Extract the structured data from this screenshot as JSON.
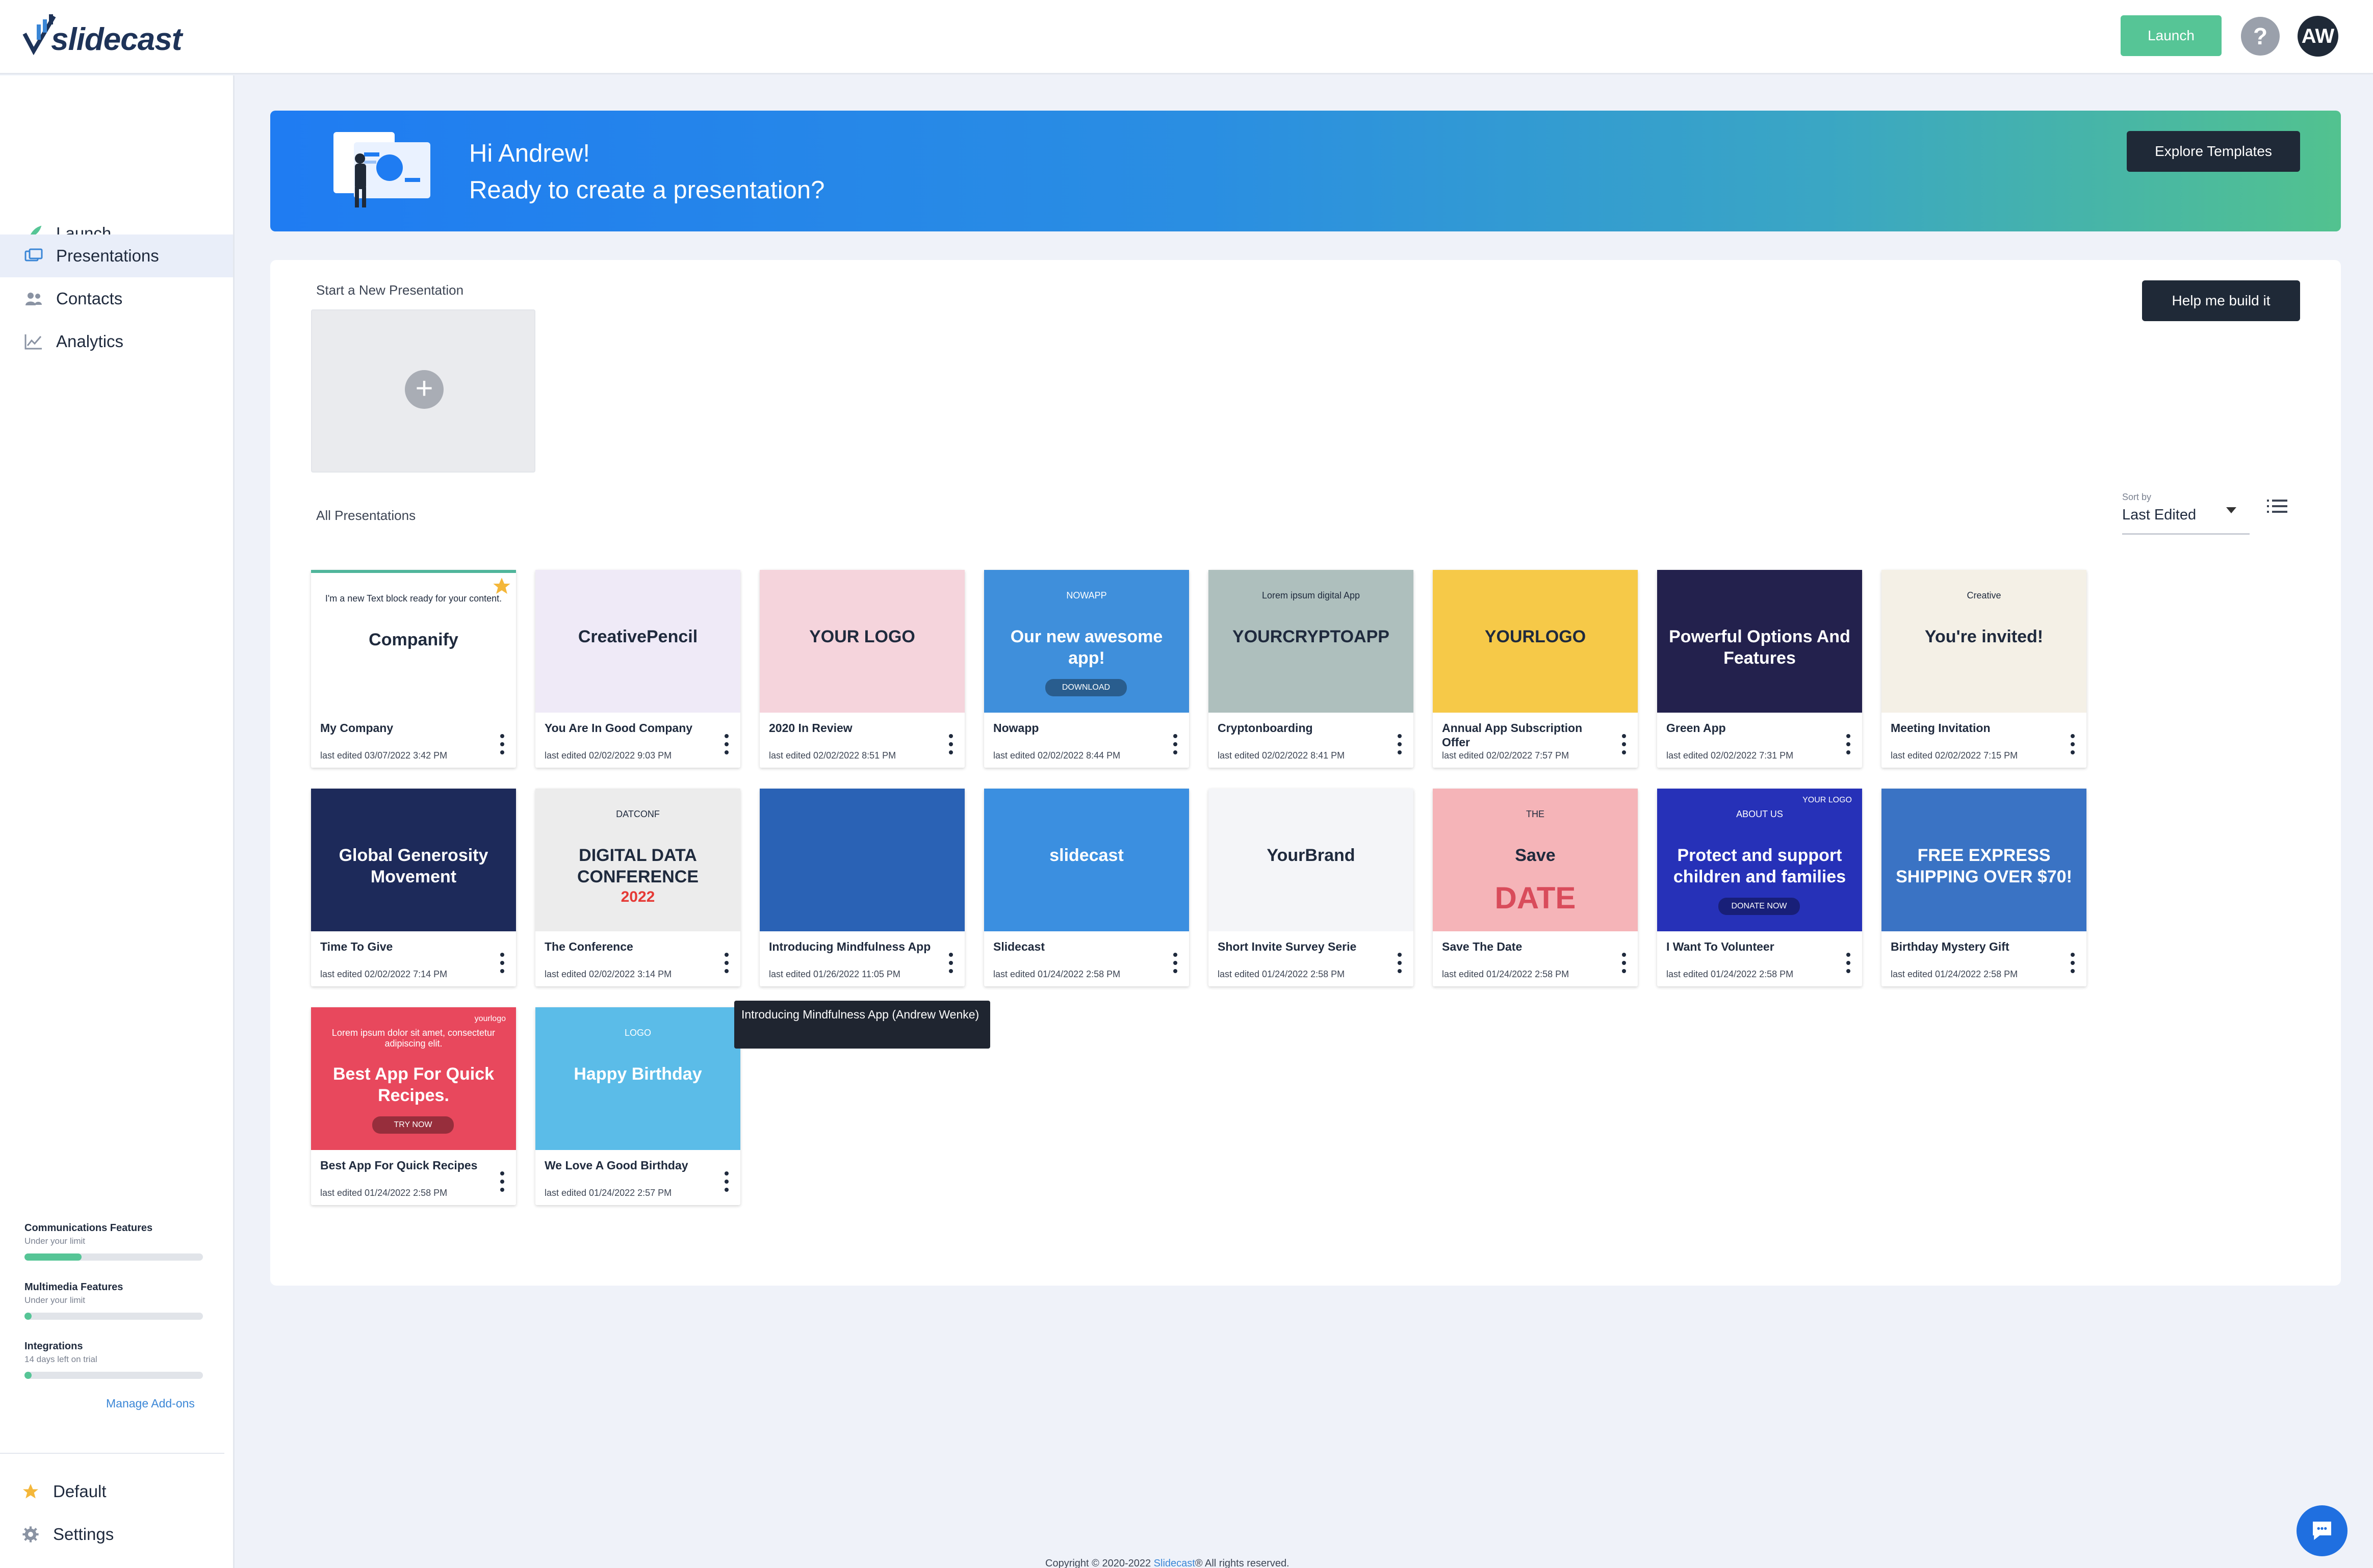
{
  "app": {
    "logo_text": "slidecast"
  },
  "topbar": {
    "launch_label": "Launch",
    "help_label": "?",
    "avatar_initials": "AW"
  },
  "sidebar": {
    "items": [
      {
        "label": "Launch",
        "icon": "rocket-icon"
      },
      {
        "label": "Presentations",
        "icon": "presentations-icon"
      },
      {
        "label": "Contacts",
        "icon": "contacts-icon"
      },
      {
        "label": "Analytics",
        "icon": "analytics-icon"
      }
    ],
    "features": [
      {
        "title": "Communications Features",
        "subtitle": "Under your limit",
        "progress": 0.32
      },
      {
        "title": "Multimedia Features",
        "subtitle": "Under your limit",
        "progress": 0.04
      },
      {
        "title": "Integrations",
        "subtitle": "14 days left on trial",
        "progress": 0.04
      }
    ],
    "manage_addons": "Manage Add-ons",
    "bottom": [
      {
        "label": "Default",
        "icon": "star-icon"
      },
      {
        "label": "Settings",
        "icon": "gear-icon"
      }
    ]
  },
  "banner": {
    "greeting": "Hi Andrew!",
    "subtitle": "Ready to create a presentation?",
    "explore_label": "Explore Templates"
  },
  "main": {
    "start_label": "Start a New Presentation",
    "help_build_label": "Help me build it",
    "all_label": "All Presentations",
    "sort_label": "Sort by",
    "sort_value": "Last Edited"
  },
  "presentations": [
    {
      "title": "My Company",
      "date": "last edited 03/07/2022 3:42 PM",
      "thumb_bg": "#ffffff",
      "thumb_text": "Companify",
      "thumb_sub": "I'm a new Text block ready for your content."
    },
    {
      "title": "You Are In Good Company",
      "date": "last edited 02/02/2022 9:03 PM",
      "thumb_bg": "#efeaf7",
      "thumb_text": "CreativePencil"
    },
    {
      "title": "2020 In Review",
      "date": "last edited 02/02/2022 8:51 PM",
      "thumb_bg": "#f5d4dc",
      "thumb_text": "YOUR LOGO"
    },
    {
      "title": "Nowapp",
      "date": "last edited 02/02/2022 8:44 PM",
      "thumb_bg": "#3f8fdb",
      "thumb_text": "Our new awesome app!",
      "thumb_sub": "NOWAPP",
      "thumb_btn": "DOWNLOAD"
    },
    {
      "title": "Cryptonboarding",
      "date": "last edited 02/02/2022 8:41 PM",
      "thumb_bg": "#aebfbd",
      "thumb_text": "YOURCRYPTOAPP",
      "thumb_sub": "Lorem ipsum digital App"
    },
    {
      "title": "Annual App Subscription Offer",
      "date": "last edited 02/02/2022 7:57 PM",
      "thumb_bg": "#f6c948",
      "thumb_text": "YOURLOGO"
    },
    {
      "title": "Green App",
      "date": "last edited 02/02/2022 7:31 PM",
      "thumb_bg": "#23214d",
      "thumb_text": "Powerful Options And Features"
    },
    {
      "title": "Meeting Invitation",
      "date": "last edited 02/02/2022 7:15 PM",
      "thumb_bg": "#f4f0e6",
      "thumb_text": "You're invited!",
      "thumb_sub": "Creative"
    },
    {
      "title": "Time To Give",
      "date": "last edited 02/02/2022 7:14 PM",
      "thumb_bg": "#1d2a5a",
      "thumb_text": "Global Generosity Movement"
    },
    {
      "title": "The Conference",
      "date": "last edited 02/02/2022 3:14 PM",
      "thumb_bg": "#ececec",
      "thumb_text": "DIGITAL DATA CONFERENCE",
      "thumb_year": "2022",
      "thumb_sub": "DATCONF"
    },
    {
      "title": "Introducing Mindfulness App",
      "date": "last edited 01/26/2022 11:05 PM",
      "thumb_bg": "#2a62b5",
      "thumb_text": ""
    },
    {
      "title": "Slidecast",
      "date": "last edited 01/24/2022 2:58 PM",
      "thumb_bg": "#3b8fe0",
      "thumb_text": "slidecast"
    },
    {
      "title": "Short Invite Survey Serie",
      "date": "last edited 01/24/2022 2:58 PM",
      "thumb_bg": "#f4f5f8",
      "thumb_text": "YourBrand"
    },
    {
      "title": "Save The Date",
      "date": "last edited 01/24/2022 2:58 PM",
      "thumb_bg": "#f5b4b8",
      "thumb_text": "Save",
      "thumb_sub": "THE",
      "thumb_extra": "DATE"
    },
    {
      "title": "I Want To Volunteer",
      "date": "last edited 01/24/2022 2:58 PM",
      "thumb_bg": "#2631b8",
      "thumb_text": "Protect and support children and families",
      "thumb_sub": "ABOUT US",
      "thumb_btn": "DONATE NOW",
      "thumb_logo": "YOUR LOGO"
    },
    {
      "title": "Birthday Mystery Gift",
      "date": "last edited 01/24/2022 2:58 PM",
      "thumb_bg": "#3a73c4",
      "thumb_text": "FREE EXPRESS SHIPPING OVER $70!"
    },
    {
      "title": "Best App For Quick Recipes",
      "date": "last edited 01/24/2022 2:58 PM",
      "thumb_bg": "#e8485d",
      "thumb_text": "Best App For Quick Recipes.",
      "thumb_sub": "Lorem ipsum dolor sit amet, consectetur adipiscing elit.",
      "thumb_btn": "TRY NOW",
      "thumb_logo": "yourlogo"
    },
    {
      "title": "We Love A Good Birthday",
      "date": "last edited 01/24/2022 2:57 PM",
      "thumb_bg": "#5bbce8",
      "thumb_text": "Happy Birthday",
      "thumb_sub": "LOGO"
    }
  ],
  "tooltip": "Introducing Mindfulness App (Andrew Wenke)",
  "footer": {
    "prefix": "Copyright © 2020-2022 ",
    "link": "Slidecast",
    "suffix": "® All rights reserved."
  },
  "colors": {
    "accent_green": "#56c596",
    "dark_button": "#1f2937",
    "link_blue": "#3a86d6"
  }
}
